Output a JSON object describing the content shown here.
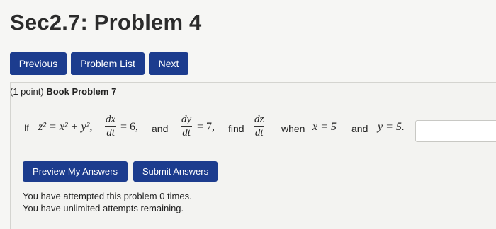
{
  "page": {
    "title": "Sec2.7: Problem 4"
  },
  "nav": {
    "previous_label": "Previous",
    "problem_list_label": "Problem List",
    "next_label": "Next"
  },
  "problem": {
    "points": "(1 point)",
    "heading": "Book Problem 7",
    "if_word": "If",
    "eq_main": "z² = x² + y²,",
    "frac1_num": "dx",
    "frac1_den": "dt",
    "eq1_rest": "= 6,",
    "and_word_1": "and",
    "frac2_num": "dy",
    "frac2_den": "dt",
    "eq2_rest": "= 7,",
    "find_word": "find",
    "frac3_num": "dz",
    "frac3_den": "dt",
    "when_word": "when",
    "x_eq": "x = 5",
    "and_word_2": "and",
    "y_eq": "y = 5.",
    "answer_value": ""
  },
  "actions": {
    "preview_label": "Preview My Answers",
    "submit_label": "Submit Answers"
  },
  "status": {
    "attempts_text": "You have attempted this problem 0 times.",
    "remaining_text": "You have unlimited attempts remaining."
  },
  "colors": {
    "button_bg": "#1c3c8e",
    "page_bg": "#f6f6f4"
  }
}
